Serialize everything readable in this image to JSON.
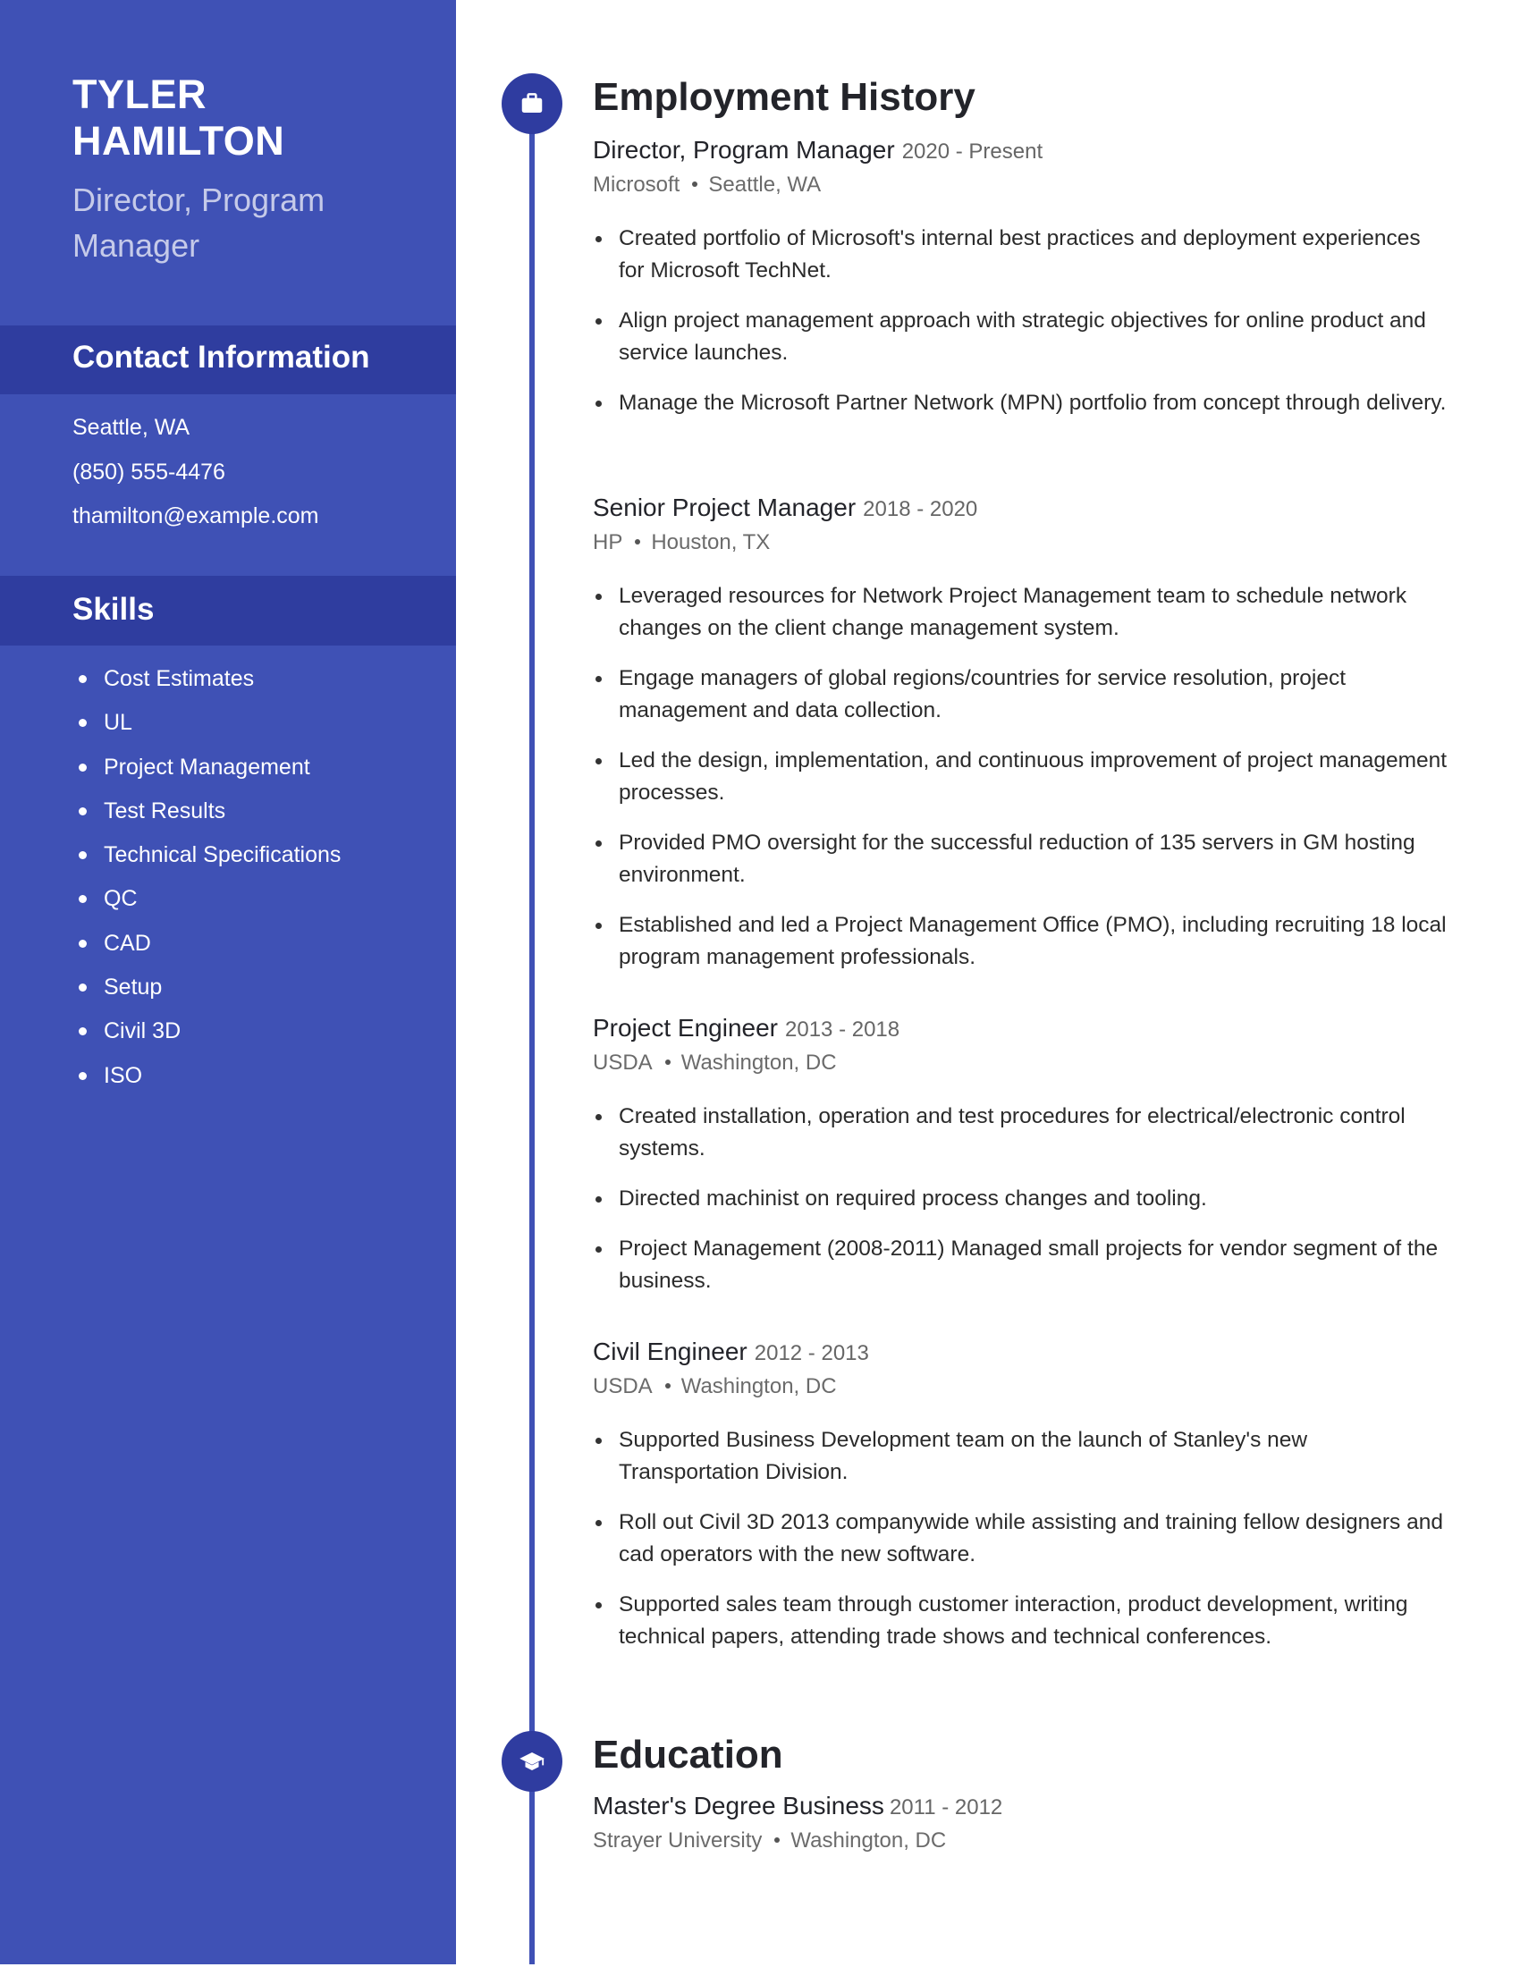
{
  "profile": {
    "first_name": "TYLER",
    "last_name": "HAMILTON",
    "title_line1": "Director, Program",
    "title_line2": "Manager"
  },
  "contact": {
    "heading": "Contact Information",
    "location": "Seattle, WA",
    "phone": "(850) 555-4476",
    "email": "thamilton@example.com"
  },
  "skills": {
    "heading": "Skills",
    "items": [
      "Cost Estimates",
      "UL",
      "Project Management",
      "Test Results",
      "Technical Specifications",
      "QC",
      "CAD",
      "Setup",
      "Civil 3D",
      "ISO"
    ]
  },
  "employment": {
    "heading": "Employment History",
    "icon": "briefcase-icon",
    "jobs": [
      {
        "title": "Director, Program Manager",
        "dates": "2020 - Present",
        "company": "Microsoft",
        "location": "Seattle, WA",
        "bullets": [
          "Created portfolio of Microsoft's internal best practices and deployment experiences for Microsoft TechNet.",
          "Align project management approach with strategic objectives for online product and service launches.",
          "Manage the Microsoft Partner Network (MPN) portfolio from concept through delivery."
        ]
      },
      {
        "title": "Senior Project Manager",
        "dates": "2018 - 2020",
        "company": "HP",
        "location": "Houston, TX",
        "bullets": [
          "Leveraged resources for Network Project Management team to schedule network changes on the client change management system.",
          "Engage managers of global regions/countries for service resolution, project management and data collection.",
          "Led the design, implementation, and continuous improvement of project management processes.",
          "Provided PMO oversight for the successful reduction of 135 servers in GM hosting environment.",
          "Established and led a Project Management Office (PMO), including recruiting 18 local program management professionals."
        ]
      },
      {
        "title": "Project Engineer",
        "dates": "2013 - 2018",
        "company": "USDA",
        "location": "Washington, DC",
        "bullets": [
          "Created installation, operation and test procedures for electrical/electronic control systems.",
          "Directed machinist on required process changes and tooling.",
          "Project Management (2008-2011) Managed small projects for vendor segment of the business."
        ]
      },
      {
        "title": "Civil Engineer",
        "dates": "2012 - 2013",
        "company": "USDA",
        "location": "Washington, DC",
        "bullets": [
          "Supported Business Development team on the launch of Stanley's new Transportation Division.",
          "Roll out Civil 3D 2013 companywide while assisting and training fellow designers and cad operators with the new software.",
          "Supported sales team through customer interaction, product development, writing technical papers, attending trade shows and technical conferences."
        ]
      }
    ]
  },
  "education": {
    "heading": "Education",
    "icon": "graduation-cap-icon",
    "entries": [
      {
        "degree": "Master's Degree Business",
        "dates": "2011 - 2012",
        "school": "Strayer University",
        "location": "Washington, DC"
      }
    ]
  },
  "colors": {
    "sidebar": "#3f51b5",
    "sidebar_band": "#2f3d9f",
    "timeline_node": "#2f3ca0",
    "subtitle_text": "#c5cae9",
    "heading_text": "#23242a"
  }
}
